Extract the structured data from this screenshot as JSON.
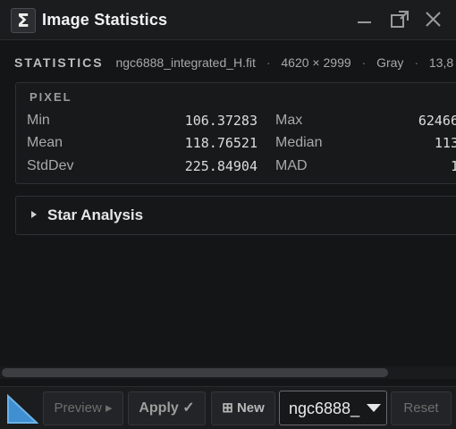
{
  "window": {
    "title": "Image Statistics",
    "icon": "sigma-icon"
  },
  "header": {
    "label": "STATISTICS",
    "filename": "ngc6888_integrated_H.fit",
    "dimensions": "4620 × 2999",
    "color_mode": "Gray",
    "extra": "13,8",
    "separator": "·"
  },
  "pixel": {
    "heading": "PIXEL",
    "rows": [
      {
        "label": "Min",
        "value": "106.37283",
        "label2": "Max",
        "value2": "62466"
      },
      {
        "label": "Mean",
        "value": "118.76521",
        "label2": "Median",
        "value2": "113"
      },
      {
        "label": "StdDev",
        "value": "225.84904",
        "label2": "MAD",
        "value2": "1"
      }
    ]
  },
  "star_analysis": {
    "label": "Star Analysis"
  },
  "toolbar": {
    "preview_label": "Preview ▸",
    "apply_label": "Apply ✓",
    "new_label": "⊞ New",
    "view_selected": "ngc6888_",
    "reset_label": "Reset"
  }
}
